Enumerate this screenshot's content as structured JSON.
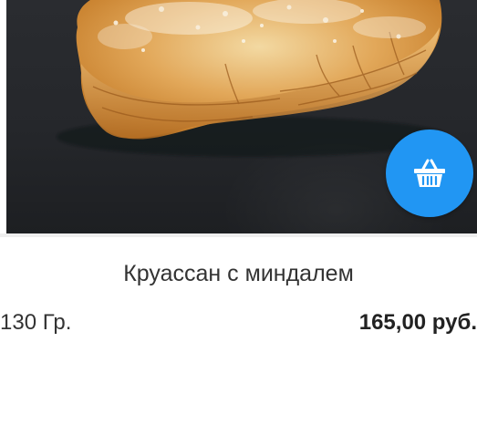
{
  "product": {
    "name": "Круассан с миндалем",
    "weight": "130 Гр.",
    "price": "165,00 руб.",
    "image_icon": "croissant-photo",
    "cart_icon": "basket-icon"
  },
  "colors": {
    "accent": "#2196f3",
    "text": "#333333",
    "price_text": "#222222"
  }
}
